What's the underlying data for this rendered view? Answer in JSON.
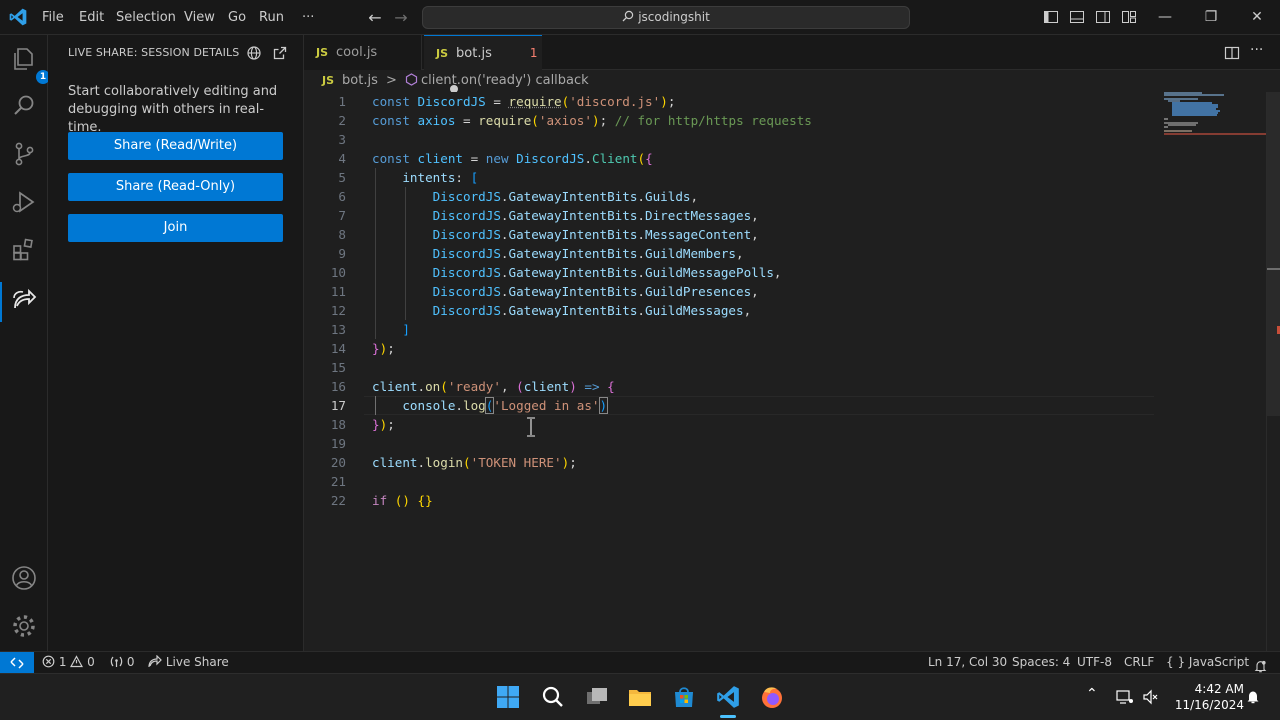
{
  "window": {
    "search_text": "jscodingshit",
    "menu": [
      "File",
      "Edit",
      "Selection",
      "View",
      "Go",
      "Run",
      "···"
    ]
  },
  "activity_bar": {
    "explorer_badge": "1"
  },
  "sidebar": {
    "title": "LIVE SHARE: SESSION DETAILS",
    "description": "Start collaboratively editing and debugging with others in real-time.",
    "buttons": [
      "Share (Read/Write)",
      "Share (Read-Only)",
      "Join"
    ]
  },
  "tabs": [
    {
      "icon_text": "JS",
      "label": "cool.js",
      "active": false
    },
    {
      "icon_text": "JS",
      "label": "bot.js",
      "active": true,
      "problems": "1",
      "dirty": true
    }
  ],
  "breadcrumb": {
    "file_icon_text": "JS",
    "file": "bot.js",
    "separator": ">",
    "symbol": "client.on('ready') callback"
  },
  "editor": {
    "current_line": 17,
    "line_numbers": [
      "1",
      "2",
      "3",
      "4",
      "5",
      "6",
      "7",
      "8",
      "9",
      "10",
      "11",
      "12",
      "13",
      "14",
      "15",
      "16",
      "17",
      "18",
      "19",
      "20",
      "21",
      "22"
    ]
  },
  "status_bar": {
    "errors": "1",
    "warnings": "0",
    "ports": "0",
    "live_share": "Live Share",
    "position": "Ln 17, Col 30",
    "indent": "Spaces: 4",
    "encoding": "UTF-8",
    "eol": "CRLF",
    "language_prefix": "{ }",
    "language": "JavaScript"
  },
  "taskbar": {
    "time": "4:42 AM",
    "date": "11/16/2024"
  },
  "colors": {
    "accent": "#0078d4",
    "js_icon": "#cbcb41",
    "error": "#f88070"
  }
}
